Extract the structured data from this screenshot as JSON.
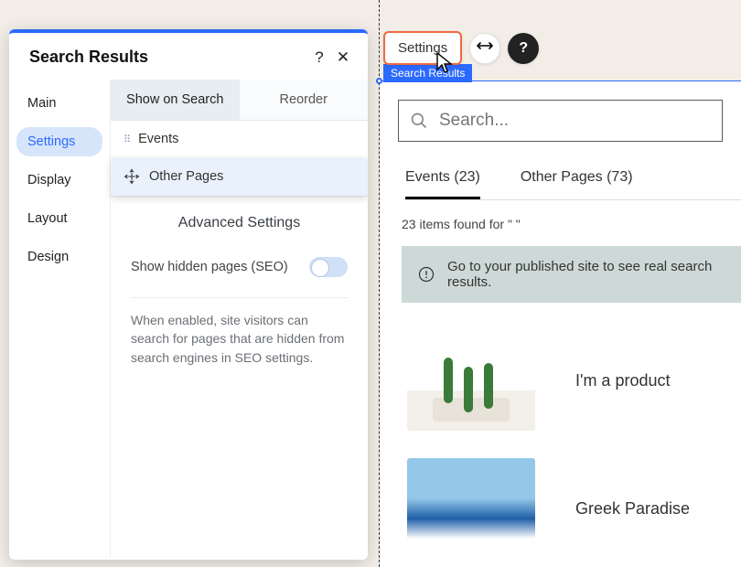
{
  "panel": {
    "title": "Search Results",
    "nav": [
      "Main",
      "Settings",
      "Display",
      "Layout",
      "Design"
    ],
    "nav_active_index": 1,
    "sub_tabs": {
      "show": "Show on Search",
      "reorder": "Reorder",
      "active": "show"
    },
    "drag_items": [
      "Events",
      "Other Pages"
    ],
    "advanced_title": "Advanced Settings",
    "seo_toggle_label": "Show hidden pages (SEO)",
    "seo_help": "When enabled, site visitors can search for pages that are hidden from search engines in SEO settings."
  },
  "top": {
    "settings_btn": "Settings",
    "tooltip": "Search Results"
  },
  "preview": {
    "search_placeholder": "Search...",
    "tabs": [
      {
        "label": "Events (23)",
        "active": true
      },
      {
        "label": "Other Pages (73)",
        "active": false
      }
    ],
    "found_text": "23 items found for \" \"",
    "banner": "Go to your published site to see real search results.",
    "results": [
      {
        "title": "I'm a product",
        "thumb": "cactus"
      },
      {
        "title": "Greek Paradise",
        "thumb": "sea"
      }
    ]
  }
}
